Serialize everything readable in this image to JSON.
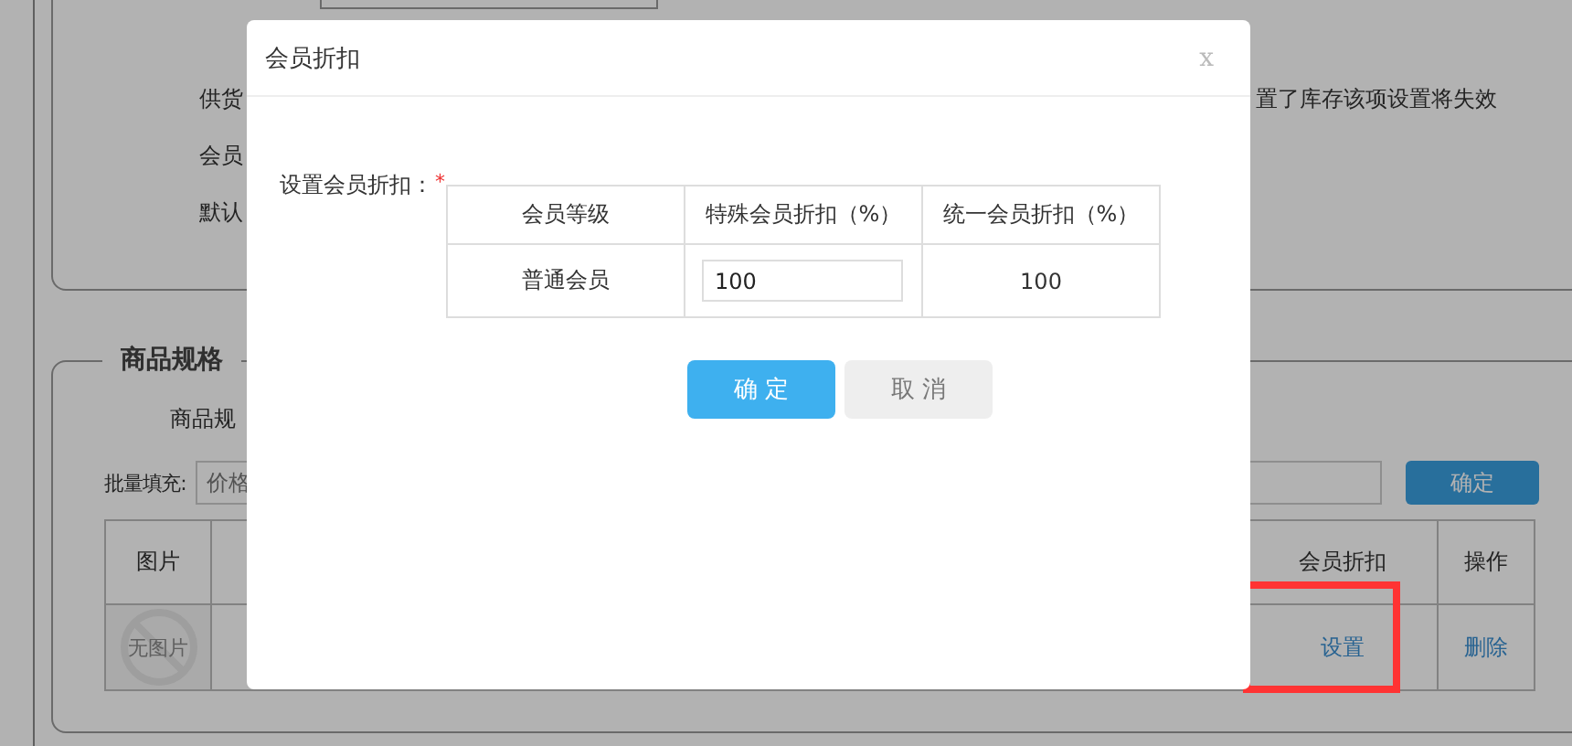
{
  "page": {
    "form_rows": [
      {
        "label": "供货"
      },
      {
        "label": "会员"
      },
      {
        "label": "默认"
      }
    ],
    "stock_note": "置了库存该项设置将失效",
    "spec_section": {
      "legend": "商品规格",
      "spec_label": "商品规",
      "batch_fill": {
        "label": "批量填充:",
        "placeholder": "价格",
        "button": "确定"
      },
      "table": {
        "columns": [
          "图片",
          "会员折扣",
          "操作"
        ],
        "rows": [
          {
            "image_placeholder": "无图片",
            "discount_action": "设置",
            "operation_action": "删除",
            "highlighted": true
          }
        ]
      }
    }
  },
  "dialog": {
    "title": "会员折扣",
    "close": "x",
    "field_label": "设置会员折扣：",
    "required_mark": "*",
    "table": {
      "columns": [
        "会员等级",
        "特殊会员折扣（%）",
        "统一会员折扣（%）"
      ],
      "rows": [
        {
          "level": "普通会员",
          "special": "100",
          "unified": "100"
        }
      ]
    },
    "buttons": [
      {
        "label": "确 定",
        "kind": "primary"
      },
      {
        "label": "取 消",
        "kind": "secondary"
      }
    ]
  }
}
